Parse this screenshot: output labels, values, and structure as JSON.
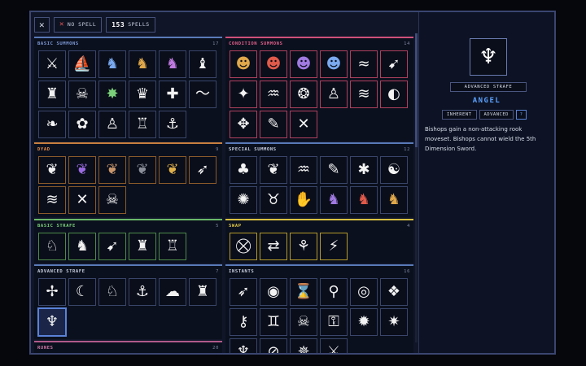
{
  "toolbar": {
    "close_glyph": "✕",
    "no_spell_label": "No Spell",
    "spell_count": "153",
    "spells_label": "Spells"
  },
  "sections": {
    "basic_summons": {
      "title": "Basic Summons",
      "count": "17",
      "color": "#5a7ab8"
    },
    "condition_summons": {
      "title": "Condition Summons",
      "count": "14",
      "color": "#d0507a"
    },
    "dyad": {
      "title": "Dyad",
      "count": "9",
      "color": "#c88040"
    },
    "special_summons": {
      "title": "Special Summons",
      "count": "12",
      "color": "#5a7ab8"
    },
    "basic_strafe": {
      "title": "Basic Strafe",
      "count": "5",
      "color": "#6ab86a"
    },
    "swap": {
      "title": "Swap",
      "count": "4",
      "color": "#d8c040"
    },
    "advanced_strafe": {
      "title": "Advanced Strafe",
      "count": "7",
      "color": "#5a7ab8"
    },
    "instants": {
      "title": "Instants",
      "count": "16",
      "color": "#5a7ab8"
    },
    "runes": {
      "title": "Runes",
      "count": "20",
      "color": "#b05a8a"
    }
  },
  "detail": {
    "icon": "angel-icon",
    "category": "Advanced Strafe",
    "name": "Angel",
    "tags": [
      "Inherent",
      "Advanced",
      "?"
    ],
    "description": "Bishops gain a non-attacking rook moveset. Bishops cannot wield the 5th Dimension Sword."
  },
  "colors": {
    "accent": "#5aa0ff",
    "selected_border": "#5a82d8",
    "background": "#101628"
  }
}
